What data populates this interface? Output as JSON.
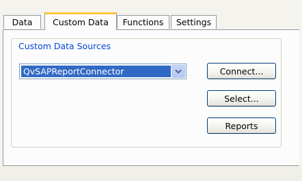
{
  "tabs": [
    {
      "label": "Data",
      "active": false
    },
    {
      "label": "Custom Data",
      "active": true
    },
    {
      "label": "Functions",
      "active": false
    },
    {
      "label": "Settings",
      "active": false
    }
  ],
  "custom_data_sources": {
    "legend": "Custom Data Sources",
    "selected_connector": "QvSAPReportConnector"
  },
  "buttons": {
    "connect": "Connect...",
    "select": "Select...",
    "reports": "Reports"
  },
  "colors": {
    "tab_highlight": "#ffc83c",
    "legend_text": "#0046d5",
    "selection": "#316ac5"
  },
  "icons": {
    "dropdown": "chevron-down-icon"
  }
}
